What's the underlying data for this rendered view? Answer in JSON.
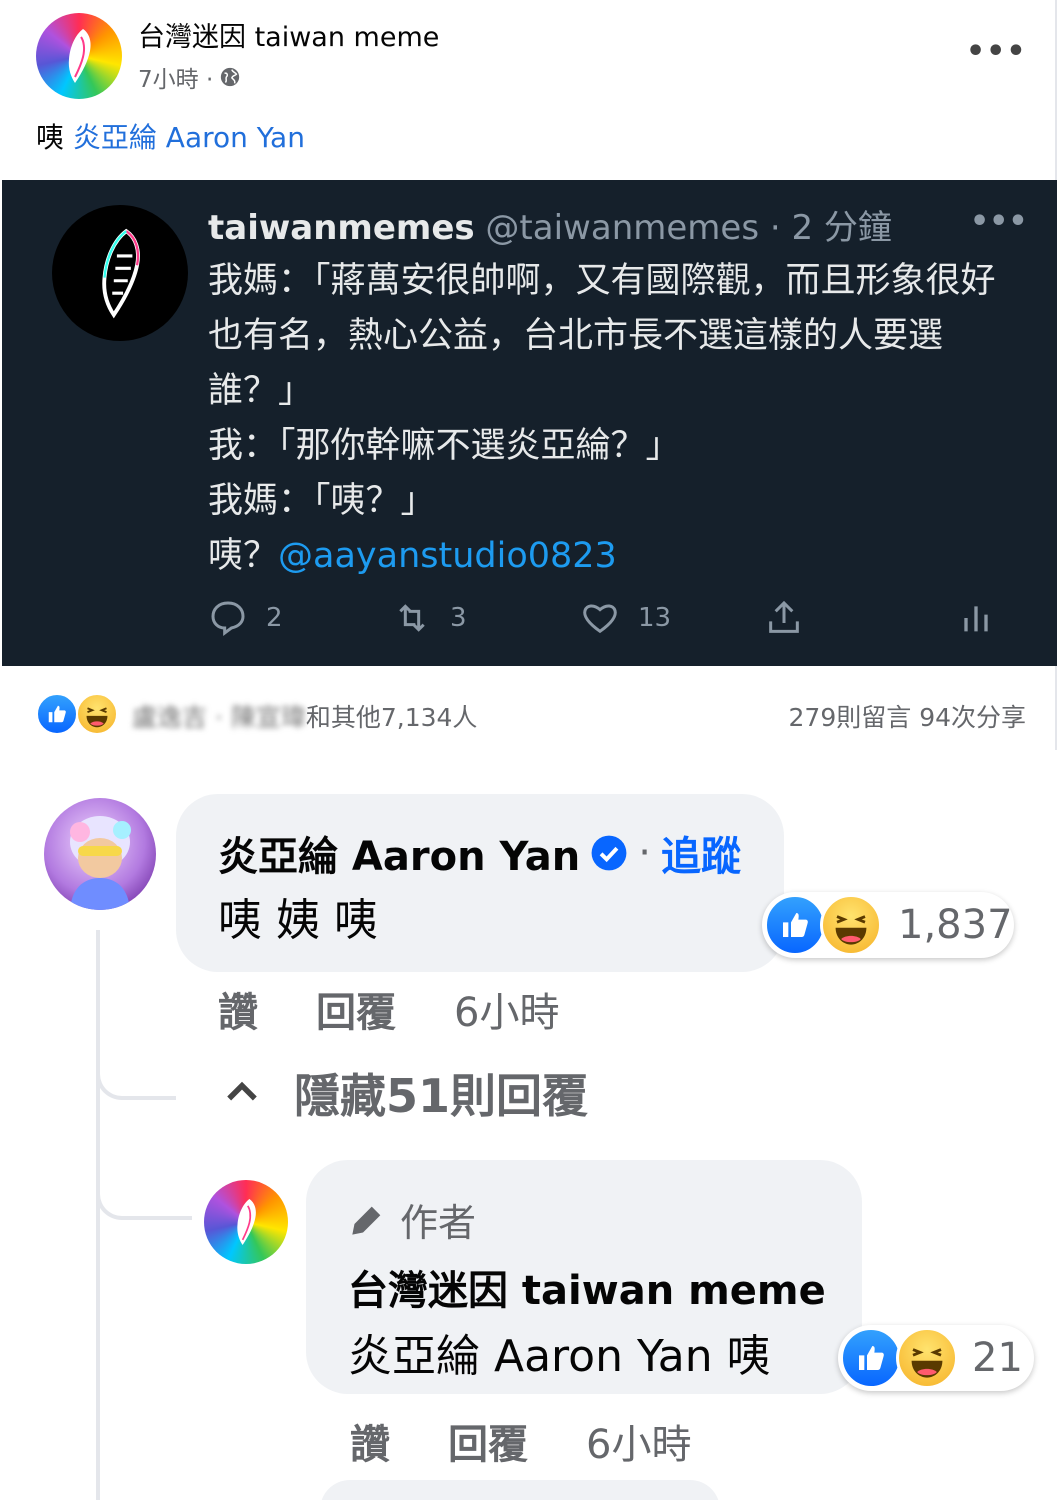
{
  "post": {
    "page_name": "台灣迷因 taiwan meme",
    "time": "7小時 ·",
    "text_prefix": "咦 ",
    "text_link": "炎亞綸 Aaron Yan"
  },
  "tweet": {
    "name": "taiwanmemes",
    "handle_time": " @taiwanmemes · 2 分鐘",
    "lines": [
      "我媽：「蔣萬安很帥啊，又有國際觀，而且形象很好也有名，熱心公益，台北市長不選這樣的人要選誰？」",
      "我：「那你幹嘛不選炎亞綸？」",
      "我媽：「咦？」"
    ],
    "last_prefix": "咦？",
    "mention": "@aayanstudio0823",
    "counts": {
      "reply": "2",
      "retweet": "3",
      "like": "13"
    }
  },
  "reactions": {
    "names_blurred": "盧逸吉 · 陳宣瑋",
    "others": "和其他7,134人",
    "comments": "279則留言",
    "shares": "94次分享"
  },
  "comment1": {
    "name": "炎亞綸 Aaron Yan",
    "separator": "·",
    "follow": "追蹤",
    "text": "咦 姨 咦",
    "reaction_count": "1,837",
    "like": "讚",
    "reply": "回覆",
    "time": "6小時",
    "hide_replies": "隱藏51則回覆"
  },
  "comment2": {
    "author_tag": "作者",
    "name": "台灣迷因 taiwan meme",
    "text": "炎亞綸 Aaron Yan 咦",
    "reaction_count": "21",
    "like": "讚",
    "reply": "回覆",
    "time": "6小時"
  },
  "colors": {
    "link": "#216fdb",
    "tweet_bg": "#15202b",
    "mention": "#1d9bf0",
    "follow": "#0866ff",
    "secondary_text": "#65676b"
  },
  "icons": [
    "globe-icon",
    "more-icon",
    "reply-icon",
    "retweet-icon",
    "heart-icon",
    "share-icon",
    "analytics-icon",
    "like-reaction-icon",
    "haha-reaction-icon",
    "verified-icon",
    "chevron-up-icon",
    "pencil-icon"
  ]
}
